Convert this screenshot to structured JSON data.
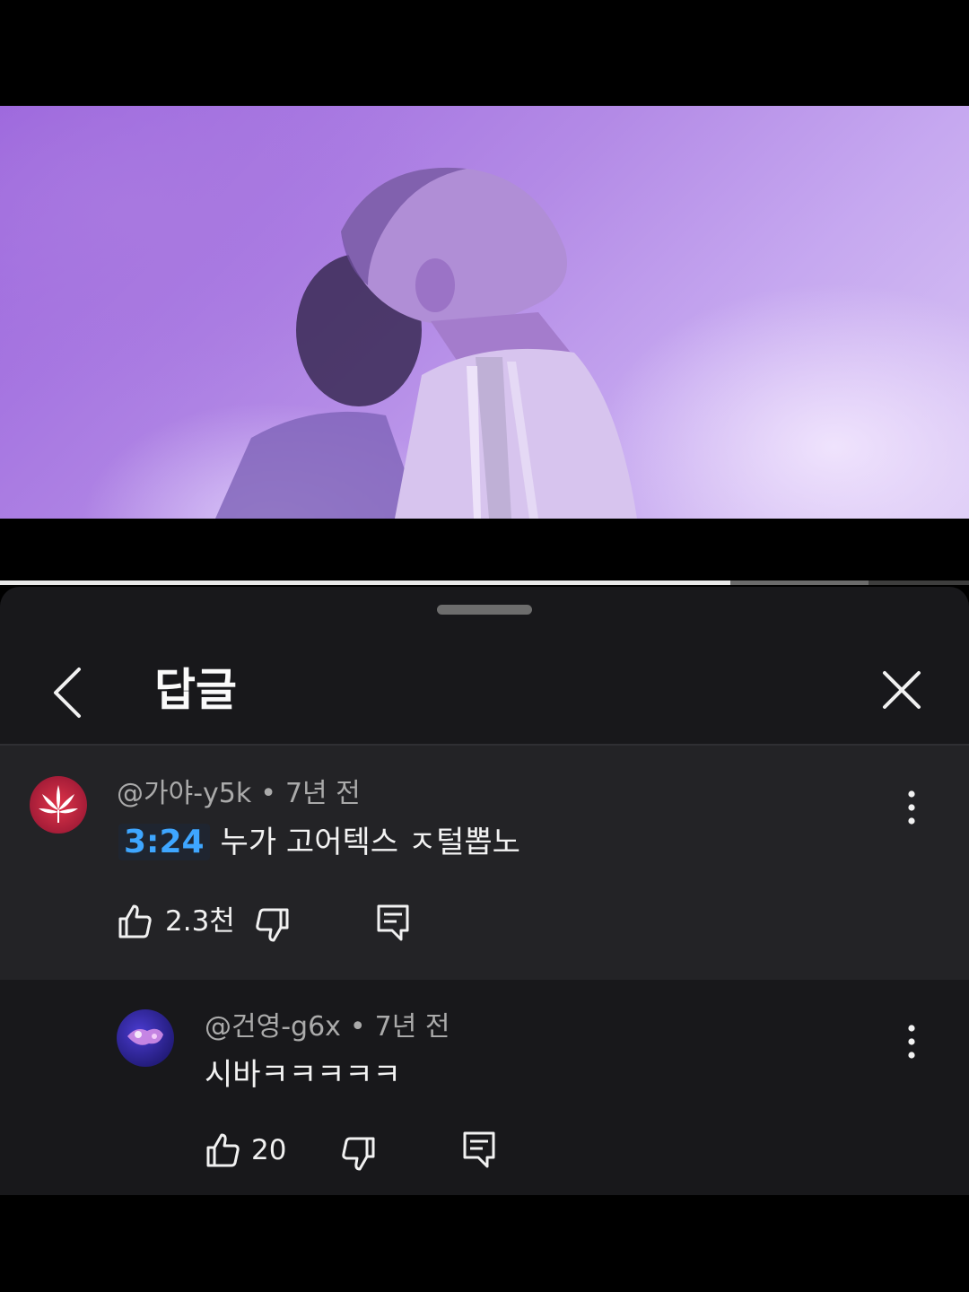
{
  "player": {
    "progress_fraction": 0.754,
    "buffer_fraction": 0.896
  },
  "sheet": {
    "title": "답글"
  },
  "parent_comment": {
    "author": "@가야-y5k",
    "separator": "•",
    "time": "7년 전",
    "timestamp": "3:24",
    "text": "누가 고어텍스 ㅈ털뽑노",
    "likes": "2.3천",
    "avatar_icon": "cannabis-leaf-icon"
  },
  "reply_comment": {
    "author": "@건영-g6x",
    "separator": "•",
    "time": "7년 전",
    "text": "시바ㅋㅋㅋㅋㅋ",
    "likes": "20",
    "avatar_icon": "purple-abstract-avatar"
  },
  "colors": {
    "accent_link": "#3ea6ff",
    "sheet_bg": "#18181b",
    "highlight_bg": "#232326"
  }
}
